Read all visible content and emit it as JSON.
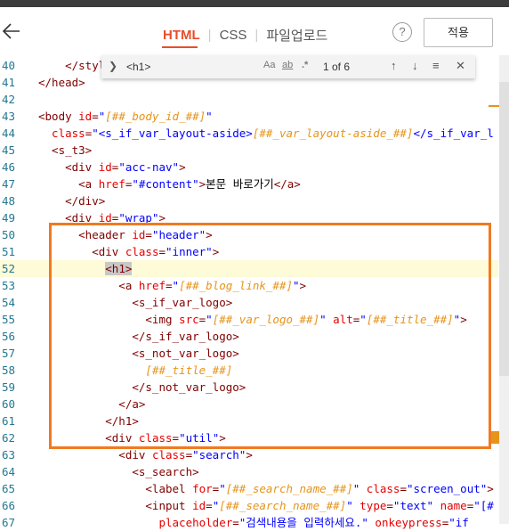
{
  "header": {
    "tabs": [
      {
        "label": "HTML",
        "active": true
      },
      {
        "label": "CSS",
        "active": false
      },
      {
        "label": "파일업로드",
        "active": false
      }
    ],
    "help_label": "?",
    "apply_label": "적용"
  },
  "find": {
    "query": "<h1>",
    "count": "1 of 6",
    "match_case": "Aa",
    "whole_word": "ab",
    "regex": ".*"
  },
  "colors": {
    "accent": "#e94e2b",
    "highlight_box": "#f07a22",
    "tag": "#800000",
    "attr": "#e50000",
    "value": "#0000ff",
    "template_var": "#e6941b"
  },
  "lines": [
    {
      "n": "40",
      "code": [
        [
          "t",
          "    </style"
        ]
      ]
    },
    {
      "n": "41",
      "code": [
        [
          "t",
          "</head>"
        ]
      ]
    },
    {
      "n": "42",
      "code": []
    },
    {
      "n": "43",
      "code": [
        [
          "t",
          "<body "
        ],
        [
          "a",
          "id"
        ],
        [
          "t",
          "="
        ],
        [
          "v",
          "\""
        ],
        [
          "var",
          "[##_body_id_##]"
        ],
        [
          "v",
          "\""
        ],
        [
          "t",
          ""
        ]
      ]
    },
    {
      "n": "44",
      "code": [
        [
          "a",
          "  class"
        ],
        [
          "t",
          "="
        ],
        [
          "v",
          "\"<s_if_var_layout-aside>"
        ],
        [
          "var",
          "[##_var_layout-aside_##]"
        ],
        [
          "v",
          "</s_if_var_l"
        ]
      ]
    },
    {
      "n": "45",
      "code": [
        [
          "t",
          "  <s_t3>"
        ]
      ]
    },
    {
      "n": "46",
      "code": [
        [
          "t",
          "    <div "
        ],
        [
          "a",
          "id"
        ],
        [
          "t",
          "="
        ],
        [
          "v",
          "\"acc-nav\""
        ],
        [
          "t",
          ">"
        ]
      ]
    },
    {
      "n": "47",
      "code": [
        [
          "t",
          "      <a "
        ],
        [
          "a",
          "href"
        ],
        [
          "t",
          "="
        ],
        [
          "v",
          "\"#content\""
        ],
        [
          "t",
          ">"
        ],
        [
          "txt",
          "본문 바로가기"
        ],
        [
          "t",
          "</a>"
        ]
      ]
    },
    {
      "n": "48",
      "code": [
        [
          "t",
          "    </div>"
        ]
      ]
    },
    {
      "n": "49",
      "code": [
        [
          "t",
          "    <div "
        ],
        [
          "a",
          "id"
        ],
        [
          "t",
          "="
        ],
        [
          "v",
          "\"wrap\""
        ],
        [
          "t",
          ">"
        ]
      ]
    },
    {
      "n": "50",
      "code": [
        [
          "t",
          "      <header "
        ],
        [
          "a",
          "id"
        ],
        [
          "t",
          "="
        ],
        [
          "v",
          "\"header\""
        ],
        [
          "t",
          ">"
        ]
      ]
    },
    {
      "n": "51",
      "code": [
        [
          "t",
          "        <div "
        ],
        [
          "a",
          "class"
        ],
        [
          "t",
          "="
        ],
        [
          "v",
          "\"inner\""
        ],
        [
          "t",
          ">"
        ]
      ]
    },
    {
      "n": "52",
      "code": [
        [
          "t",
          "          "
        ],
        [
          "sel",
          "<h1>"
        ]
      ],
      "highlight": true
    },
    {
      "n": "53",
      "code": [
        [
          "t",
          "            <a "
        ],
        [
          "a",
          "href"
        ],
        [
          "t",
          "="
        ],
        [
          "v",
          "\""
        ],
        [
          "var",
          "[##_blog_link_##]"
        ],
        [
          "v",
          "\""
        ],
        [
          "t",
          ">"
        ]
      ]
    },
    {
      "n": "54",
      "code": [
        [
          "t",
          "              <s_if_var_logo>"
        ]
      ]
    },
    {
      "n": "55",
      "code": [
        [
          "t",
          "                <img "
        ],
        [
          "a",
          "src"
        ],
        [
          "t",
          "="
        ],
        [
          "v",
          "\""
        ],
        [
          "var",
          "[##_var_logo_##]"
        ],
        [
          "v",
          "\""
        ],
        [
          "t",
          " "
        ],
        [
          "a",
          "alt"
        ],
        [
          "t",
          "="
        ],
        [
          "v",
          "\""
        ],
        [
          "var",
          "[##_title_##]"
        ],
        [
          "v",
          "\""
        ],
        [
          "t",
          ">"
        ]
      ]
    },
    {
      "n": "56",
      "code": [
        [
          "t",
          "              </s_if_var_logo>"
        ]
      ]
    },
    {
      "n": "57",
      "code": [
        [
          "t",
          "              <s_not_var_logo>"
        ]
      ]
    },
    {
      "n": "58",
      "code": [
        [
          "t",
          "                "
        ],
        [
          "var",
          "[##_title_##]"
        ]
      ]
    },
    {
      "n": "59",
      "code": [
        [
          "t",
          "              </s_not_var_logo>"
        ]
      ]
    },
    {
      "n": "60",
      "code": [
        [
          "t",
          "            </a>"
        ]
      ]
    },
    {
      "n": "61",
      "code": [
        [
          "t",
          "          </h1>"
        ]
      ]
    },
    {
      "n": "62",
      "code": [
        [
          "t",
          "          <div "
        ],
        [
          "a",
          "class"
        ],
        [
          "t",
          "="
        ],
        [
          "v",
          "\"util\""
        ],
        [
          "t",
          ">"
        ]
      ]
    },
    {
      "n": "63",
      "code": [
        [
          "t",
          "            <div "
        ],
        [
          "a",
          "class"
        ],
        [
          "t",
          "="
        ],
        [
          "v",
          "\"search\""
        ],
        [
          "t",
          ">"
        ]
      ]
    },
    {
      "n": "64",
      "code": [
        [
          "t",
          "              <s_search>"
        ]
      ]
    },
    {
      "n": "65",
      "code": [
        [
          "t",
          "                <label "
        ],
        [
          "a",
          "for"
        ],
        [
          "t",
          "="
        ],
        [
          "v",
          "\""
        ],
        [
          "var",
          "[##_search_name_##]"
        ],
        [
          "v",
          "\""
        ],
        [
          "t",
          " "
        ],
        [
          "a",
          "class"
        ],
        [
          "t",
          "="
        ],
        [
          "v",
          "\"screen_out\""
        ],
        [
          "t",
          ">"
        ]
      ]
    },
    {
      "n": "66",
      "code": [
        [
          "t",
          "                <input "
        ],
        [
          "a",
          "id"
        ],
        [
          "t",
          "="
        ],
        [
          "v",
          "\""
        ],
        [
          "var",
          "[##_search_name_##]"
        ],
        [
          "v",
          "\""
        ],
        [
          "t",
          " "
        ],
        [
          "a",
          "type"
        ],
        [
          "t",
          "="
        ],
        [
          "v",
          "\"text\""
        ],
        [
          "t",
          " "
        ],
        [
          "a",
          "name"
        ],
        [
          "t",
          "="
        ],
        [
          "v",
          "\"[#"
        ]
      ]
    },
    {
      "n": "67",
      "code": [
        [
          "a",
          "                  placeholder"
        ],
        [
          "t",
          "="
        ],
        [
          "v",
          "\"검색내용을 입력하세요.\""
        ],
        [
          "t",
          " "
        ],
        [
          "a",
          "onkeypress"
        ],
        [
          "t",
          "="
        ],
        [
          "v",
          "\"if"
        ]
      ]
    }
  ]
}
